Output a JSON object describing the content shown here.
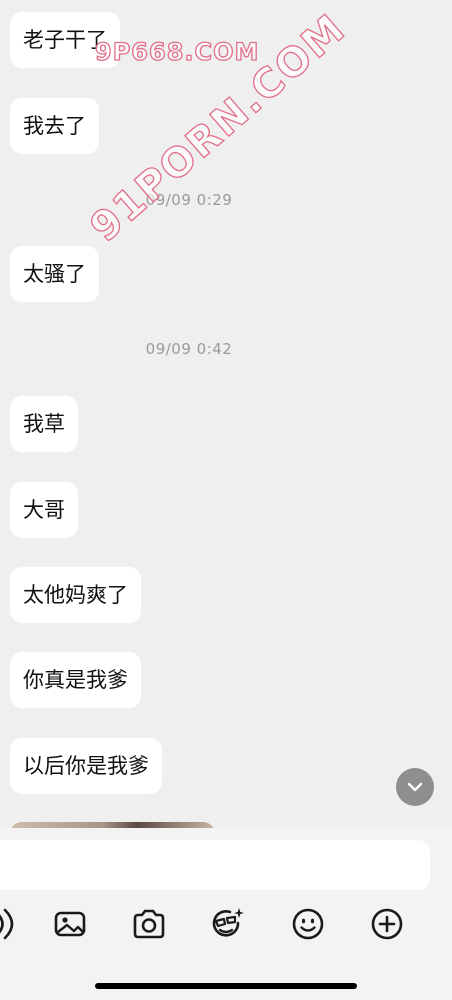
{
  "watermarks": [
    "9P668.COM",
    "91PORN.COM"
  ],
  "messages": [
    {
      "text": "老子干了"
    },
    {
      "text": "我去了"
    },
    {
      "time": "09/09 0:29"
    },
    {
      "text": "太骚了"
    },
    {
      "time": "09/09 0:42"
    },
    {
      "text": "我草"
    },
    {
      "text": "大哥"
    },
    {
      "text": "太他妈爽了"
    },
    {
      "text": "你真是我爹"
    },
    {
      "text": "以后你是我爹"
    }
  ],
  "composer": {
    "placeholder": "",
    "toolbar_icons": [
      "voice-icon",
      "image-icon",
      "camera-icon",
      "sticker-icon",
      "emoji-icon",
      "plus-icon"
    ]
  },
  "colors": {
    "background": "#efefef",
    "bubble": "#ffffff",
    "timestamp": "#9a9a9a",
    "scroll_button": "#8e8e8e",
    "watermark_stroke": "#e26e88"
  }
}
